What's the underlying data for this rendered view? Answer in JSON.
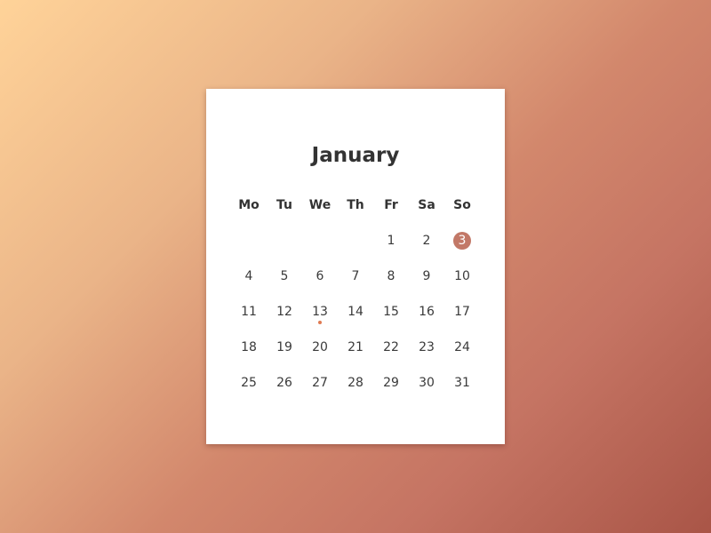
{
  "calendar": {
    "month": "January",
    "weekdays": [
      "Mo",
      "Tu",
      "We",
      "Th",
      "Fr",
      "Sa",
      "So"
    ],
    "weeks": [
      [
        "",
        "",
        "",
        "",
        "1",
        "2",
        "3"
      ],
      [
        "4",
        "5",
        "6",
        "7",
        "8",
        "9",
        "10"
      ],
      [
        "11",
        "12",
        "13",
        "14",
        "15",
        "16",
        "17"
      ],
      [
        "18",
        "19",
        "20",
        "21",
        "22",
        "23",
        "24"
      ],
      [
        "25",
        "26",
        "27",
        "28",
        "29",
        "30",
        "31"
      ]
    ],
    "selected_day": "3",
    "event_days": [
      "13"
    ],
    "colors": {
      "selected": "#c27867",
      "event_dot": "#e07a52"
    }
  }
}
